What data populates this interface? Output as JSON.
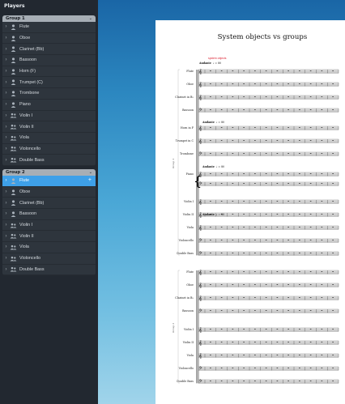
{
  "panel": {
    "title": "Players",
    "groups": [
      {
        "name": "Group 1",
        "players": [
          {
            "name": "Flute",
            "type": "single"
          },
          {
            "name": "Oboe",
            "type": "single"
          },
          {
            "name": "Clarinet (Bb)",
            "type": "single"
          },
          {
            "name": "Bassoon",
            "type": "single"
          },
          {
            "name": "Horn (F)",
            "type": "single"
          },
          {
            "name": "Trumpet (C)",
            "type": "single"
          },
          {
            "name": "Trombone",
            "type": "single"
          },
          {
            "name": "Piano",
            "type": "single"
          },
          {
            "name": "Violin I",
            "type": "section"
          },
          {
            "name": "Violin II",
            "type": "section"
          },
          {
            "name": "Viola",
            "type": "section"
          },
          {
            "name": "Violoncello",
            "type": "section"
          },
          {
            "name": "Double Bass",
            "type": "section"
          }
        ]
      },
      {
        "name": "Group 2",
        "players": [
          {
            "name": "Flute",
            "type": "single",
            "selected": true
          },
          {
            "name": "Oboe",
            "type": "single"
          },
          {
            "name": "Clarinet (Bb)",
            "type": "single"
          },
          {
            "name": "Bassoon",
            "type": "single"
          },
          {
            "name": "Violin I",
            "type": "section"
          },
          {
            "name": "Violin II",
            "type": "section"
          },
          {
            "name": "Viola",
            "type": "section"
          },
          {
            "name": "Violoncello",
            "type": "section"
          },
          {
            "name": "Double Bass",
            "type": "section"
          }
        ]
      }
    ],
    "add_icon": "+",
    "expand_icon": "chevron-right-icon",
    "collapse_icon": "chevron-down-icon"
  },
  "score": {
    "title": "System objects vs groups",
    "system_object_label": "system objects",
    "tempo": "Andante",
    "tempo_mark": "♩ = 80",
    "group_label_1": "Group 1",
    "group_label_2": "Group 2",
    "system1_staves": [
      "Flute",
      "Oboe",
      "Clarinet in B♭",
      "Bassoon",
      "Horn in F",
      "Trumpet in C",
      "Trombone",
      "Piano",
      "",
      "Violin I",
      "Violin II",
      "Viola",
      "Violoncello",
      "Double Bass"
    ],
    "system2_staves": [
      "Flute",
      "Oboe",
      "Clarinet in B♭",
      "Bassoon",
      "Violin I",
      "Violin II",
      "Viola",
      "Violoncello",
      "Double Bass"
    ]
  },
  "colors": {
    "selected_row": "#3ea0e8",
    "group_header": "#a7aeb5",
    "system_object": "#dd2233"
  }
}
